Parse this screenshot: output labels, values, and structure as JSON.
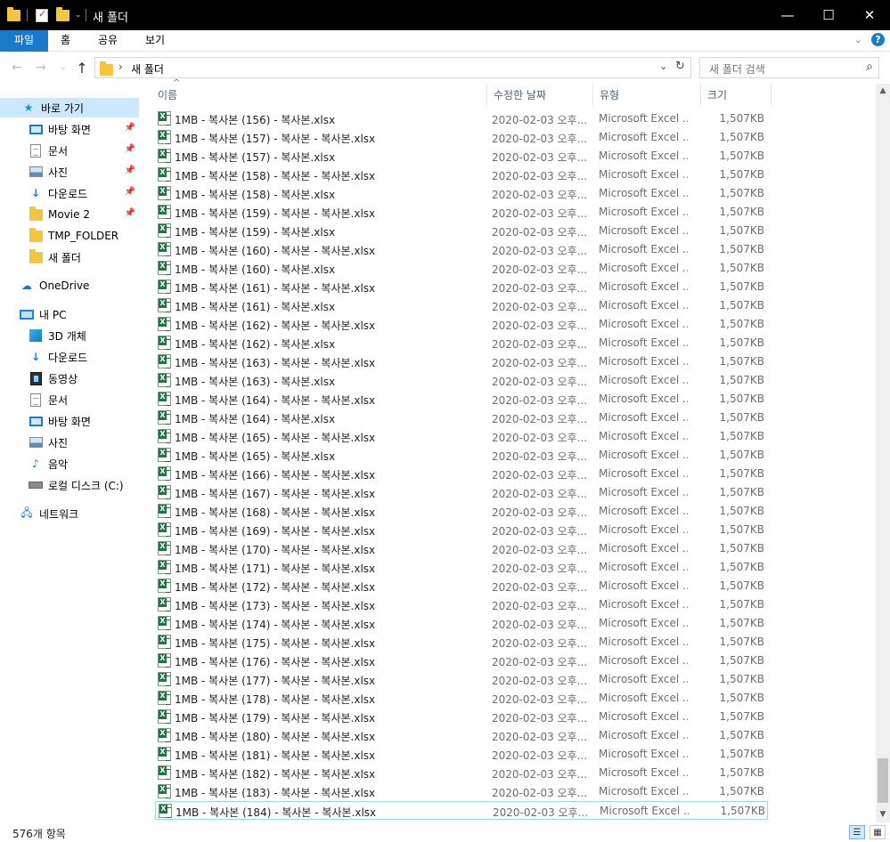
{
  "window": {
    "title": "새 폴더",
    "controls": {
      "minimize": "—",
      "maximize": "☐",
      "close": "✕"
    }
  },
  "ribbon": {
    "tabs": [
      "파일",
      "홈",
      "공유",
      "보기"
    ],
    "help_glyph": "?"
  },
  "address": {
    "path": "새 폴더",
    "search_placeholder": "새 폴더 검색"
  },
  "sidebar": {
    "items": [
      {
        "label": "바로 가기",
        "icon": "star-icon"
      },
      {
        "label": "바탕 화면",
        "icon": "desktop-icon",
        "pinned": true
      },
      {
        "label": "문서",
        "icon": "documents-icon",
        "pinned": true
      },
      {
        "label": "사진",
        "icon": "pictures-icon",
        "pinned": true
      },
      {
        "label": "다운로드",
        "icon": "download-icon",
        "pinned": true
      },
      {
        "label": "Movie 2",
        "icon": "folder-icon",
        "pinned": true
      },
      {
        "label": "TMP_FOLDER",
        "icon": "folder-icon"
      },
      {
        "label": "새 폴더",
        "icon": "folder-icon"
      },
      {
        "label": "OneDrive",
        "icon": "onedrive-icon"
      },
      {
        "label": "내 PC",
        "icon": "pc-icon"
      },
      {
        "label": "3D 개체",
        "icon": "3d-objects-icon"
      },
      {
        "label": "다운로드",
        "icon": "download-icon"
      },
      {
        "label": "동영상",
        "icon": "video-icon"
      },
      {
        "label": "문서",
        "icon": "documents-icon"
      },
      {
        "label": "바탕 화면",
        "icon": "desktop-icon"
      },
      {
        "label": "사진",
        "icon": "pictures-icon"
      },
      {
        "label": "음악",
        "icon": "music-icon"
      },
      {
        "label": "로컬 디스크 (C:)",
        "icon": "drive-icon"
      },
      {
        "label": "네트워크",
        "icon": "network-icon"
      }
    ]
  },
  "columns": {
    "name": "이름",
    "date": "수정한 날짜",
    "type": "유형",
    "size": "크기"
  },
  "files": [
    {
      "name": "1MB - 복사본 (156) - 복사본.xlsx",
      "date": "2020-02-03 오후...",
      "type": "Microsoft Excel ...",
      "size": "1,507KB"
    },
    {
      "name": "1MB - 복사본 (157) - 복사본 - 복사본.xlsx",
      "date": "2020-02-03 오후...",
      "type": "Microsoft Excel ...",
      "size": "1,507KB"
    },
    {
      "name": "1MB - 복사본 (157) - 복사본.xlsx",
      "date": "2020-02-03 오후...",
      "type": "Microsoft Excel ...",
      "size": "1,507KB"
    },
    {
      "name": "1MB - 복사본 (158) - 복사본 - 복사본.xlsx",
      "date": "2020-02-03 오후...",
      "type": "Microsoft Excel ...",
      "size": "1,507KB"
    },
    {
      "name": "1MB - 복사본 (158) - 복사본.xlsx",
      "date": "2020-02-03 오후...",
      "type": "Microsoft Excel ...",
      "size": "1,507KB"
    },
    {
      "name": "1MB - 복사본 (159) - 복사본 - 복사본.xlsx",
      "date": "2020-02-03 오후...",
      "type": "Microsoft Excel ...",
      "size": "1,507KB"
    },
    {
      "name": "1MB - 복사본 (159) - 복사본.xlsx",
      "date": "2020-02-03 오후...",
      "type": "Microsoft Excel ...",
      "size": "1,507KB"
    },
    {
      "name": "1MB - 복사본 (160) - 복사본 - 복사본.xlsx",
      "date": "2020-02-03 오후...",
      "type": "Microsoft Excel ...",
      "size": "1,507KB"
    },
    {
      "name": "1MB - 복사본 (160) - 복사본.xlsx",
      "date": "2020-02-03 오후...",
      "type": "Microsoft Excel ...",
      "size": "1,507KB"
    },
    {
      "name": "1MB - 복사본 (161) - 복사본 - 복사본.xlsx",
      "date": "2020-02-03 오후...",
      "type": "Microsoft Excel ...",
      "size": "1,507KB"
    },
    {
      "name": "1MB - 복사본 (161) - 복사본.xlsx",
      "date": "2020-02-03 오후...",
      "type": "Microsoft Excel ...",
      "size": "1,507KB"
    },
    {
      "name": "1MB - 복사본 (162) - 복사본 - 복사본.xlsx",
      "date": "2020-02-03 오후...",
      "type": "Microsoft Excel ...",
      "size": "1,507KB"
    },
    {
      "name": "1MB - 복사본 (162) - 복사본.xlsx",
      "date": "2020-02-03 오후...",
      "type": "Microsoft Excel ...",
      "size": "1,507KB"
    },
    {
      "name": "1MB - 복사본 (163) - 복사본 - 복사본.xlsx",
      "date": "2020-02-03 오후...",
      "type": "Microsoft Excel ...",
      "size": "1,507KB"
    },
    {
      "name": "1MB - 복사본 (163) - 복사본.xlsx",
      "date": "2020-02-03 오후...",
      "type": "Microsoft Excel ...",
      "size": "1,507KB"
    },
    {
      "name": "1MB - 복사본 (164) - 복사본 - 복사본.xlsx",
      "date": "2020-02-03 오후...",
      "type": "Microsoft Excel ...",
      "size": "1,507KB"
    },
    {
      "name": "1MB - 복사본 (164) - 복사본.xlsx",
      "date": "2020-02-03 오후...",
      "type": "Microsoft Excel ...",
      "size": "1,507KB"
    },
    {
      "name": "1MB - 복사본 (165) - 복사본 - 복사본.xlsx",
      "date": "2020-02-03 오후...",
      "type": "Microsoft Excel ...",
      "size": "1,507KB"
    },
    {
      "name": "1MB - 복사본 (165) - 복사본.xlsx",
      "date": "2020-02-03 오후...",
      "type": "Microsoft Excel ...",
      "size": "1,507KB"
    },
    {
      "name": "1MB - 복사본 (166) - 복사본 - 복사본.xlsx",
      "date": "2020-02-03 오후...",
      "type": "Microsoft Excel ...",
      "size": "1,507KB"
    },
    {
      "name": "1MB - 복사본 (167) - 복사본 - 복사본.xlsx",
      "date": "2020-02-03 오후...",
      "type": "Microsoft Excel ...",
      "size": "1,507KB"
    },
    {
      "name": "1MB - 복사본 (168) - 복사본 - 복사본.xlsx",
      "date": "2020-02-03 오후...",
      "type": "Microsoft Excel ...",
      "size": "1,507KB"
    },
    {
      "name": "1MB - 복사본 (169) - 복사본 - 복사본.xlsx",
      "date": "2020-02-03 오후...",
      "type": "Microsoft Excel ...",
      "size": "1,507KB"
    },
    {
      "name": "1MB - 복사본 (170) - 복사본 - 복사본.xlsx",
      "date": "2020-02-03 오후...",
      "type": "Microsoft Excel ...",
      "size": "1,507KB"
    },
    {
      "name": "1MB - 복사본 (171) - 복사본 - 복사본.xlsx",
      "date": "2020-02-03 오후...",
      "type": "Microsoft Excel ...",
      "size": "1,507KB"
    },
    {
      "name": "1MB - 복사본 (172) - 복사본 - 복사본.xlsx",
      "date": "2020-02-03 오후...",
      "type": "Microsoft Excel ...",
      "size": "1,507KB"
    },
    {
      "name": "1MB - 복사본 (173) - 복사본 - 복사본.xlsx",
      "date": "2020-02-03 오후...",
      "type": "Microsoft Excel ...",
      "size": "1,507KB"
    },
    {
      "name": "1MB - 복사본 (174) - 복사본 - 복사본.xlsx",
      "date": "2020-02-03 오후...",
      "type": "Microsoft Excel ...",
      "size": "1,507KB"
    },
    {
      "name": "1MB - 복사본 (175) - 복사본 - 복사본.xlsx",
      "date": "2020-02-03 오후...",
      "type": "Microsoft Excel ...",
      "size": "1,507KB"
    },
    {
      "name": "1MB - 복사본 (176) - 복사본 - 복사본.xlsx",
      "date": "2020-02-03 오후...",
      "type": "Microsoft Excel ...",
      "size": "1,507KB"
    },
    {
      "name": "1MB - 복사본 (177) - 복사본 - 복사본.xlsx",
      "date": "2020-02-03 오후...",
      "type": "Microsoft Excel ...",
      "size": "1,507KB"
    },
    {
      "name": "1MB - 복사본 (178) - 복사본 - 복사본.xlsx",
      "date": "2020-02-03 오후...",
      "type": "Microsoft Excel ...",
      "size": "1,507KB"
    },
    {
      "name": "1MB - 복사본 (179) - 복사본 - 복사본.xlsx",
      "date": "2020-02-03 오후...",
      "type": "Microsoft Excel ...",
      "size": "1,507KB"
    },
    {
      "name": "1MB - 복사본 (180) - 복사본 - 복사본.xlsx",
      "date": "2020-02-03 오후...",
      "type": "Microsoft Excel ...",
      "size": "1,507KB"
    },
    {
      "name": "1MB - 복사본 (181) - 복사본 - 복사본.xlsx",
      "date": "2020-02-03 오후...",
      "type": "Microsoft Excel ...",
      "size": "1,507KB"
    },
    {
      "name": "1MB - 복사본 (182) - 복사본 - 복사본.xlsx",
      "date": "2020-02-03 오후...",
      "type": "Microsoft Excel ...",
      "size": "1,507KB"
    },
    {
      "name": "1MB - 복사본 (183) - 복사본 - 복사본.xlsx",
      "date": "2020-02-03 오후...",
      "type": "Microsoft Excel ...",
      "size": "1,507KB"
    },
    {
      "name": "1MB - 복사본 (184) - 복사본 - 복사본.xlsx",
      "date": "2020-02-03 오후...",
      "type": "Microsoft Excel ...",
      "size": "1,507KB",
      "focused": true
    }
  ],
  "status": {
    "item_count": "576개 항목"
  },
  "colors": {
    "accent": "#1979ca",
    "selection": "#cce8ff",
    "titlebar": "#000000"
  }
}
